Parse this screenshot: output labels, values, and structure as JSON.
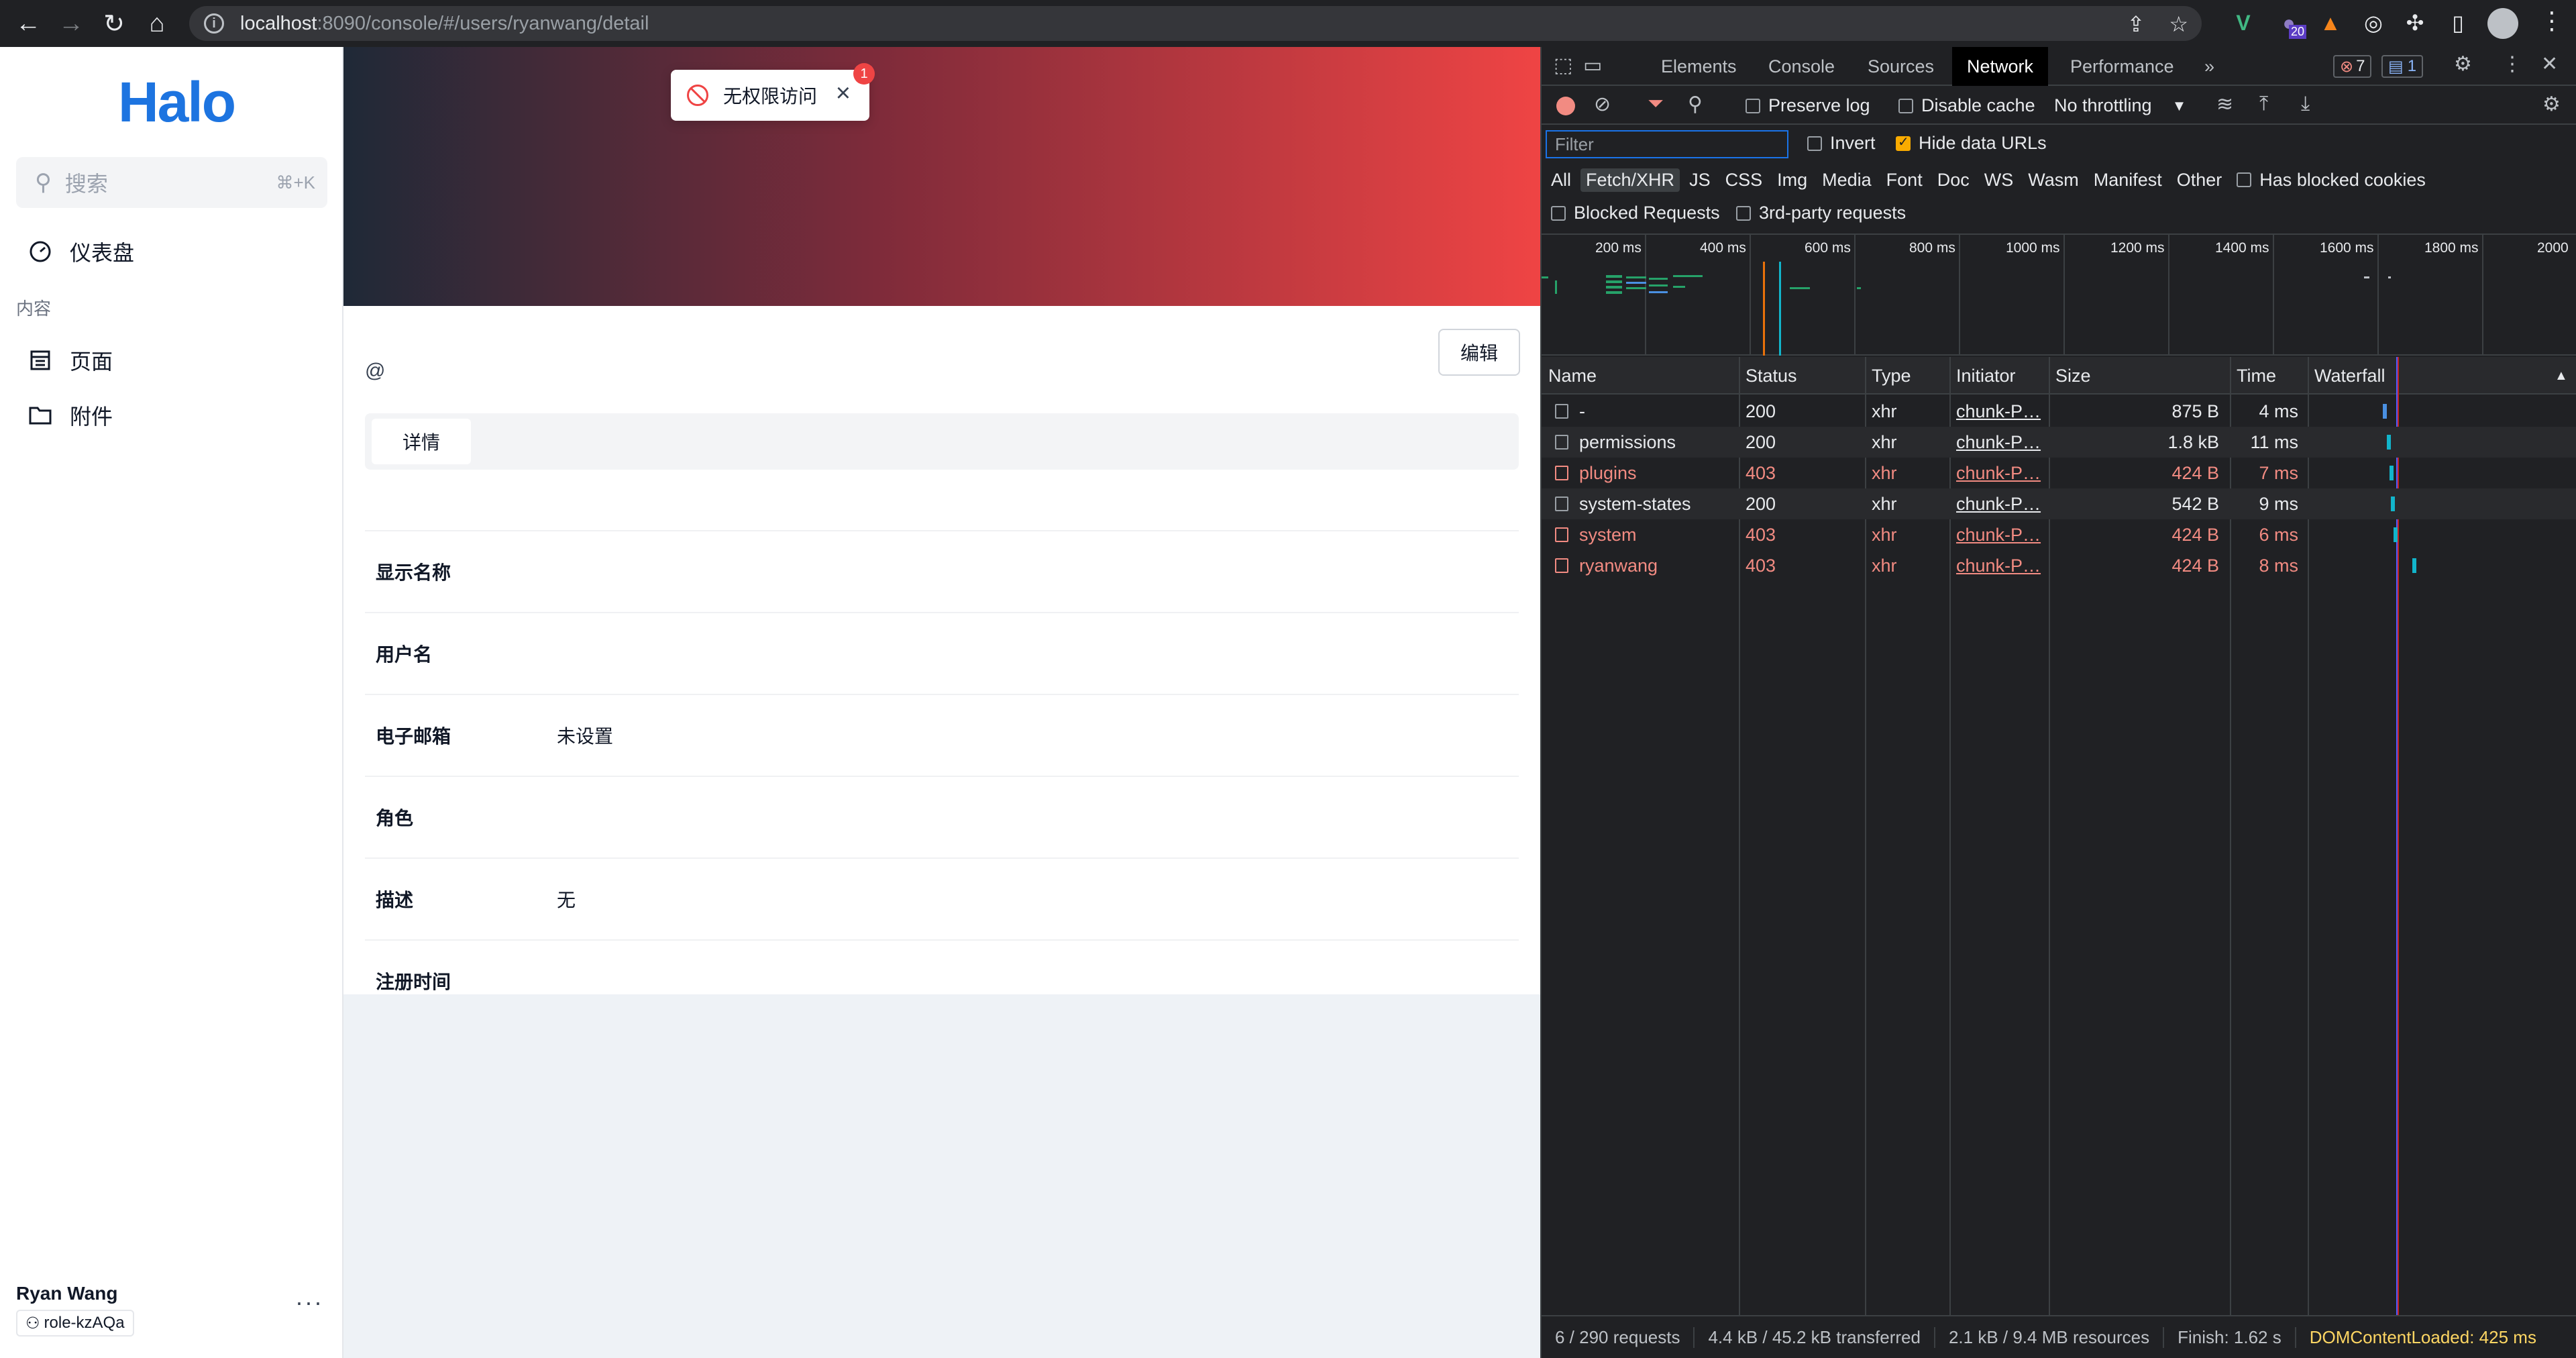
{
  "browser": {
    "url_host": "localhost",
    "url_rest": ":8090/console/#/users/ryanwang/detail",
    "ext_badge": "20"
  },
  "sidebar": {
    "logo": "Halo",
    "search_placeholder": "搜索",
    "search_shortcut": "⌘+K",
    "dashboard": "仪表盘",
    "group_content": "内容",
    "pages": "页面",
    "attachments": "附件",
    "user_name": "Ryan Wang",
    "user_role": "role-kzAQa",
    "more": "···"
  },
  "toast": {
    "message": "无权限访问",
    "count": "1"
  },
  "detail": {
    "handle": "@",
    "edit_button": "编辑",
    "tab_detail": "详情",
    "rows": [
      {
        "label": "显示名称",
        "value": ""
      },
      {
        "label": "用户名",
        "value": ""
      },
      {
        "label": "电子邮箱",
        "value": "未设置"
      },
      {
        "label": "角色",
        "value": ""
      },
      {
        "label": "描述",
        "value": "无"
      },
      {
        "label": "注册时间",
        "value": ""
      }
    ]
  },
  "devtools": {
    "tabs": [
      "Elements",
      "Console",
      "Sources",
      "Network",
      "Performance"
    ],
    "more_tabs": "»",
    "active_tab": "Network",
    "error_count": "7",
    "message_count": "1",
    "preserve_log": "Preserve log",
    "disable_cache": "Disable cache",
    "throttling": "No throttling",
    "filter_placeholder": "Filter",
    "invert": "Invert",
    "hide_data_urls": "Hide data URLs",
    "types": [
      "All",
      "Fetch/XHR",
      "JS",
      "CSS",
      "Img",
      "Media",
      "Font",
      "Doc",
      "WS",
      "Wasm",
      "Manifest",
      "Other"
    ],
    "selected_type": "Fetch/XHR",
    "has_blocked_cookies": "Has blocked cookies",
    "blocked_requests": "Blocked Requests",
    "third_party": "3rd-party requests",
    "timeline_labels": [
      "200 ms",
      "400 ms",
      "600 ms",
      "800 ms",
      "1000 ms",
      "1200 ms",
      "1400 ms",
      "1600 ms",
      "1800 ms",
      "2000"
    ],
    "columns": [
      "Name",
      "Status",
      "Type",
      "Initiator",
      "Size",
      "Time",
      "Waterfall"
    ],
    "requests": [
      {
        "name": "-",
        "status": "200",
        "type": "xhr",
        "initiator": "chunk-P…",
        "size": "875 B",
        "time": "4 ms",
        "error": false
      },
      {
        "name": "permissions",
        "status": "200",
        "type": "xhr",
        "initiator": "chunk-P…",
        "size": "1.8 kB",
        "time": "11 ms",
        "error": false
      },
      {
        "name": "plugins",
        "status": "403",
        "type": "xhr",
        "initiator": "chunk-P…",
        "size": "424 B",
        "time": "7 ms",
        "error": true
      },
      {
        "name": "system-states",
        "status": "200",
        "type": "xhr",
        "initiator": "chunk-P…",
        "size": "542 B",
        "time": "9 ms",
        "error": false
      },
      {
        "name": "system",
        "status": "403",
        "type": "xhr",
        "initiator": "chunk-P…",
        "size": "424 B",
        "time": "6 ms",
        "error": true
      },
      {
        "name": "ryanwang",
        "status": "403",
        "type": "xhr",
        "initiator": "chunk-P…",
        "size": "424 B",
        "time": "8 ms",
        "error": true
      }
    ],
    "status_bar": {
      "requests": "6 / 290 requests",
      "transferred": "4.4 kB / 45.2 kB transferred",
      "resources": "2.1 kB / 9.4 MB resources",
      "finish": "Finish: 1.62 s",
      "dom_loaded": "DOMContentLoaded: 425 ms"
    }
  }
}
